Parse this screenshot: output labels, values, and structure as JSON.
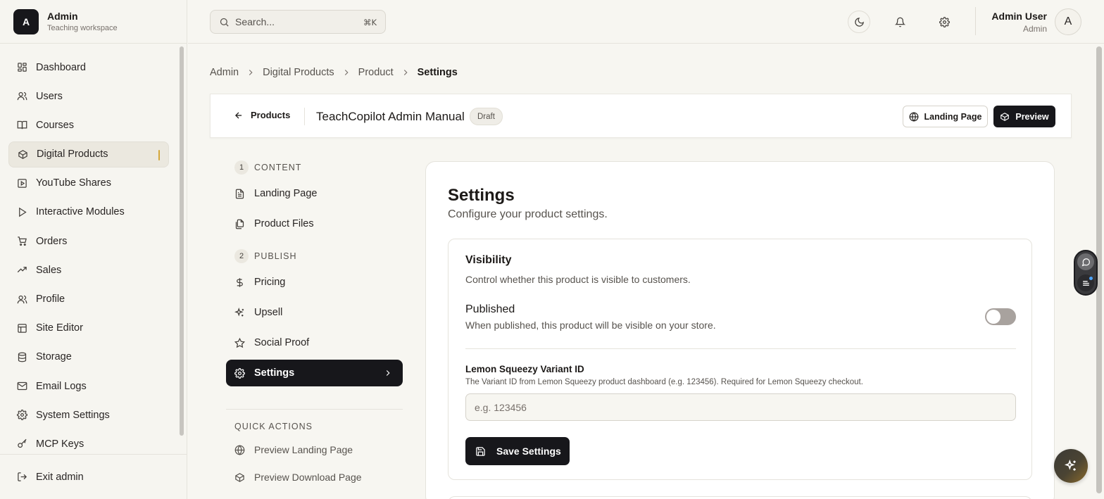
{
  "brand": {
    "initial": "A",
    "title": "Admin",
    "subtitle": "Teaching workspace"
  },
  "sidebar": {
    "items": [
      {
        "label": "Dashboard",
        "icon": "dashboard-icon"
      },
      {
        "label": "Users",
        "icon": "users-icon"
      },
      {
        "label": "Courses",
        "icon": "book-icon"
      },
      {
        "label": "Digital Products",
        "icon": "package-icon",
        "active": true
      },
      {
        "label": "YouTube Shares",
        "icon": "youtube-icon"
      },
      {
        "label": "Interactive Modules",
        "icon": "play-icon"
      },
      {
        "label": "Orders",
        "icon": "cart-icon"
      },
      {
        "label": "Sales",
        "icon": "trending-icon"
      },
      {
        "label": "Profile",
        "icon": "profile-icon"
      },
      {
        "label": "Site Editor",
        "icon": "layout-icon"
      },
      {
        "label": "Storage",
        "icon": "database-icon"
      },
      {
        "label": "Email Logs",
        "icon": "mail-icon"
      },
      {
        "label": "System Settings",
        "icon": "gear-icon"
      },
      {
        "label": "MCP Keys",
        "icon": "key-icon"
      }
    ],
    "exit_label": "Exit admin",
    "accent_color": "#d4a73a"
  },
  "header": {
    "search_placeholder": "Search...",
    "search_shortcut": "⌘K",
    "user_name": "Admin User",
    "user_role": "Admin",
    "avatar_initial": "A"
  },
  "breadcrumb": [
    "Admin",
    "Digital Products",
    "Product",
    "Settings"
  ],
  "titlebar": {
    "back_label": "Products",
    "product_title": "TeachCopilot Admin Manual",
    "status_badge": "Draft",
    "landing_page_button": "Landing Page",
    "preview_button": "Preview"
  },
  "steps": {
    "sections": [
      {
        "number": "1",
        "label": "CONTENT"
      },
      {
        "number": "2",
        "label": "PUBLISH"
      }
    ],
    "items": [
      {
        "label": "Landing Page",
        "icon": "file-text-icon"
      },
      {
        "label": "Product Files",
        "icon": "files-icon"
      },
      {
        "label": "Pricing",
        "icon": "dollar-icon"
      },
      {
        "label": "Upsell",
        "icon": "sparkles-icon"
      },
      {
        "label": "Social Proof",
        "icon": "star-icon"
      },
      {
        "label": "Settings",
        "icon": "gear-icon",
        "active": true
      }
    ],
    "quick_actions_label": "QUICK ACTIONS",
    "quick_actions": [
      {
        "label": "Preview Landing Page",
        "icon": "globe-icon"
      },
      {
        "label": "Preview Download Page",
        "icon": "package-icon"
      }
    ]
  },
  "settings": {
    "title": "Settings",
    "subtitle": "Configure your product settings.",
    "visibility_title": "Visibility",
    "visibility_subtitle": "Control whether this product is visible to customers.",
    "published_label": "Published",
    "published_help": "When published, this product will be visible on your store.",
    "published": false,
    "variant_label": "Lemon Squeezy Variant ID",
    "variant_help": "The Variant ID from Lemon Squeezy product dashboard (e.g. 123456). Required for Lemon Squeezy checkout.",
    "variant_value": "",
    "variant_placeholder": "e.g. 123456",
    "save_button": "Save Settings"
  }
}
